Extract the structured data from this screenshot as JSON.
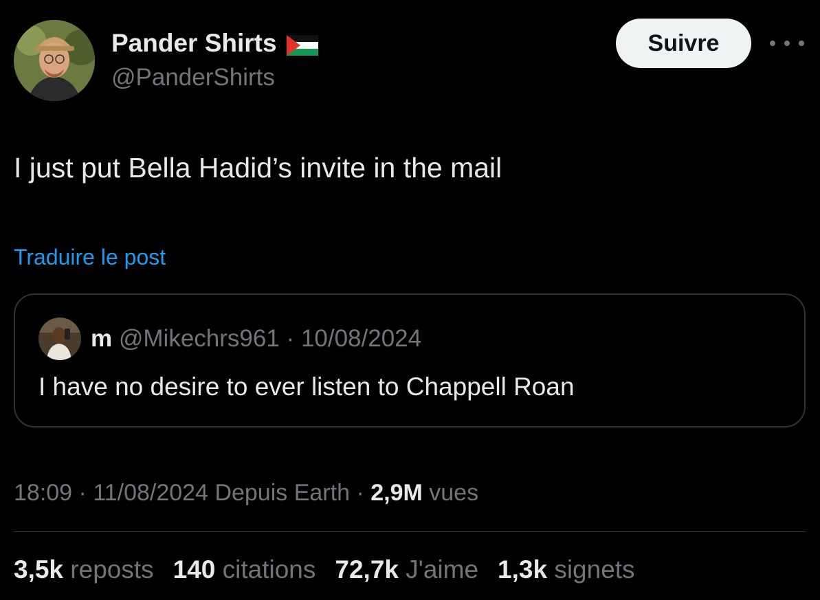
{
  "author": {
    "display_name": "Pander Shirts",
    "handle": "@PanderShirts",
    "flag_icon": "palestine-flag-icon"
  },
  "follow_button_label": "Suivre",
  "more_icon": "more-options-icon",
  "tweet": {
    "text": "I just put Bella Hadid’s invite in the mail",
    "translate_label": "Traduire le post"
  },
  "quote": {
    "name": "m",
    "handle": "@Mikechrs961",
    "separator": "·",
    "date": "10/08/2024",
    "text": "I have no desire to ever listen to Chappell Roan"
  },
  "meta": {
    "time": "18:09",
    "sep1": "·",
    "date": "11/08/2024",
    "source": "Depuis Earth",
    "sep2": "·",
    "views_count": "2,9M",
    "views_label": "vues"
  },
  "stats": [
    {
      "count": "3,5k",
      "label": "reposts"
    },
    {
      "count": "140",
      "label": "citations"
    },
    {
      "count": "72,7k",
      "label": "J'aime"
    },
    {
      "count": "1,3k",
      "label": "signets"
    }
  ],
  "colors": {
    "background": "#000000",
    "primary_text": "#e7e9ea",
    "secondary_text": "#71767b",
    "link": "#1d9bf0",
    "border": "#2f3336",
    "follow_button_bg": "#eff3f4"
  }
}
